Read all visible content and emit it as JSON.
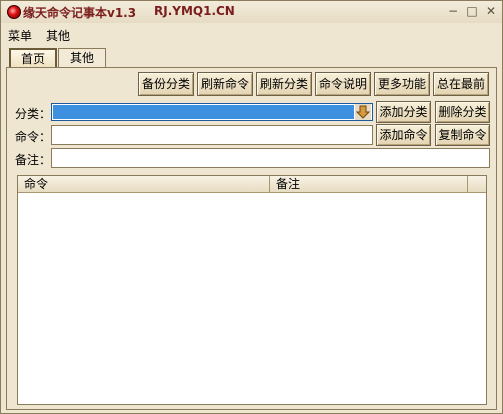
{
  "window": {
    "title": "缘天命令记事本v1.3",
    "site": "RJ.YMQ1.CN",
    "controls": {
      "minimize": "−",
      "maximize": "□",
      "close": "✕"
    }
  },
  "menu": {
    "items": [
      "菜单",
      "其他"
    ]
  },
  "tabs": {
    "home": "首页",
    "other": "其他"
  },
  "toolbar": {
    "backup": "备份分类",
    "refresh_cmd": "刷新命令",
    "refresh_cat": "刷新分类",
    "cmd_help": "命令说明",
    "more": "更多功能",
    "on_top": "总在最前"
  },
  "form": {
    "category_label": "分类：",
    "command_label": "命令：",
    "note_label": "备注：",
    "command_value": "",
    "note_value": "",
    "add_category": "添加分类",
    "delete_category": "删除分类",
    "add_command": "添加命令",
    "copy_command": "复制命令"
  },
  "table": {
    "columns": [
      "命令",
      "备注"
    ],
    "rows": []
  },
  "colors": {
    "title_text": "#7a1d1d",
    "selection": "#3d8fe0",
    "background": "#efe6d2"
  }
}
